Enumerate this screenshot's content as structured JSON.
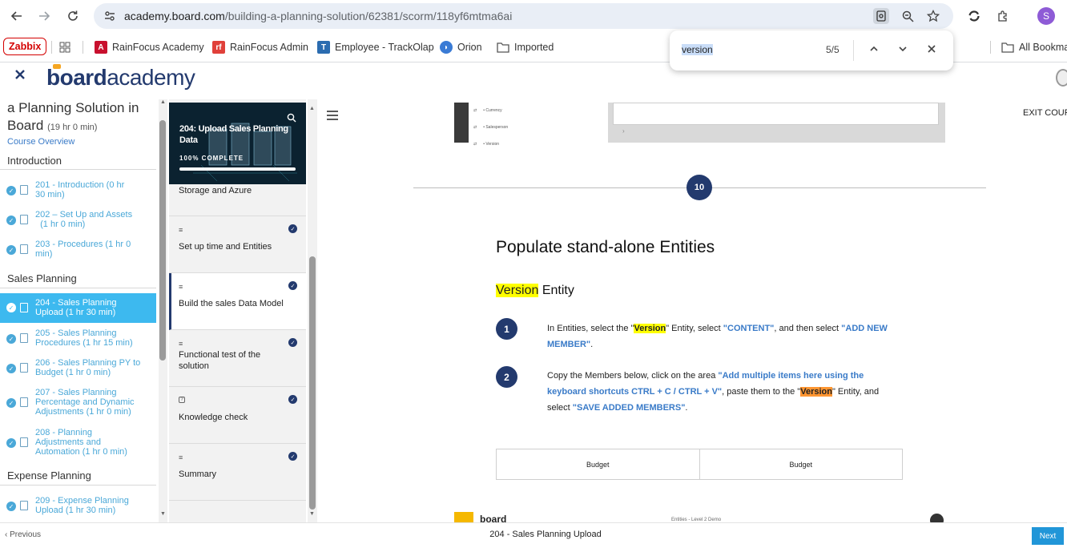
{
  "browser": {
    "url_host": "academy.board.com",
    "url_path": "/building-a-planning-solution/62381/scorm/118yf6mtma6ai",
    "profile_initial": "S",
    "profile_color": "#8e5bd6"
  },
  "bookmarks": [
    {
      "label": "Zabbix"
    },
    {
      "label": "RainFocus Academy"
    },
    {
      "label": "RainFocus Admin"
    },
    {
      "label": "Employee - TrackOlap"
    },
    {
      "label": "Orion"
    },
    {
      "label": "Imported"
    },
    {
      "label": "All Bookma"
    }
  ],
  "find": {
    "query": "version",
    "count": "5/5"
  },
  "header": {
    "logo_board": "board",
    "logo_academy": "academy",
    "exit_label": "EXIT COUR"
  },
  "sidebar": {
    "course_title_line1": "a Planning Solution in",
    "course_title_line2": "Board",
    "course_duration": "(19 hr 0 min)",
    "overview_link": "Course Overview",
    "sections": [
      {
        "title": "Introduction"
      },
      {
        "title": "Sales Planning"
      },
      {
        "title": "Expense Planning"
      }
    ],
    "lessons": [
      {
        "line1": "201 - Introduction   (0 hr",
        "line2": "30 min)",
        "line3": ""
      },
      {
        "line1": "202 – Set Up and Assets",
        "line2": "  (1 hr 0 min)",
        "line3": ""
      },
      {
        "line1": "203 - Procedures   (1 hr 0",
        "line2": "min)",
        "line3": ""
      },
      {
        "line1": "204 - Sales Planning",
        "line2": "Upload   (1 hr 30 min)",
        "line3": ""
      },
      {
        "line1": "205 - Sales Planning",
        "line2": "Procedures   (1 hr 15 min)",
        "line3": ""
      },
      {
        "line1": "206 - Sales Planning PY to",
        "line2": "Budget   (1 hr 0 min)",
        "line3": ""
      },
      {
        "line1": "207 - Sales Planning",
        "line2": "Percentage and Dynamic",
        "line3": "Adjustments   (1 hr 0 min)"
      },
      {
        "line1": "208 - Planning",
        "line2": "Adjustments and",
        "line3": "Automation   (1 hr 0 min)"
      },
      {
        "line1": "209 - Expense Planning",
        "line2": "Upload   (1 hr 30 min)",
        "line3": ""
      }
    ]
  },
  "lesson_panel": {
    "title_line1": "204: Upload Sales Planning",
    "title_line2": "Data",
    "progress_label": "100% COMPLETE",
    "progress_fraction": 1.0,
    "topics": [
      {
        "line1": "Storage and Azure",
        "line2": ""
      },
      {
        "line1": "Set up time and Entities",
        "line2": ""
      },
      {
        "line1": "Build the sales Data Model",
        "line2": ""
      },
      {
        "line1": "Functional test of the",
        "line2": "solution"
      },
      {
        "line1": "Knowledge check",
        "line2": ""
      },
      {
        "line1": "Summary",
        "line2": ""
      }
    ]
  },
  "content": {
    "screenshot_rows": [
      "Currency",
      "Salesperson",
      "Version"
    ],
    "divider_number": "10",
    "heading": "Populate stand-alone Entities",
    "subheading_mark": "Version",
    "subheading_rest": " Entity",
    "steps": [
      {
        "num": "1",
        "t1": "In Entities, select the \"",
        "m1": "Version",
        "t2": "\" Entity, select ",
        "h1": "\"CONTENT\"",
        "t3": ", and then select ",
        "h2": "\"ADD NEW MEMBER\"",
        "t4": "."
      },
      {
        "num": "2",
        "t1": "Copy the Members below, click on the area ",
        "h1": "\"Add multiple items here using the keyboard shortcuts CTRL + C / CTRL + V\"",
        "t2": ", paste them to the \"",
        "m1": "Version",
        "t3": "\" Entity, and select ",
        "h2": "\"SAVE ADDED MEMBERS\"",
        "t4": "."
      }
    ],
    "table_cells": [
      "Budget",
      "Budget"
    ],
    "bottom_logo": "board",
    "bottom_caption": "Entities - Level 2 Demo"
  },
  "footer": {
    "prev_label": "Previous",
    "center_title": "204 - Sales Planning Upload",
    "next_label": "Next"
  },
  "colors": {
    "accent_blue": "#3db9ef",
    "navy": "#233a6e",
    "link_blue": "#3a7bc8",
    "highlight_yellow": "#ffff00",
    "highlight_orange": "#ff9632"
  }
}
